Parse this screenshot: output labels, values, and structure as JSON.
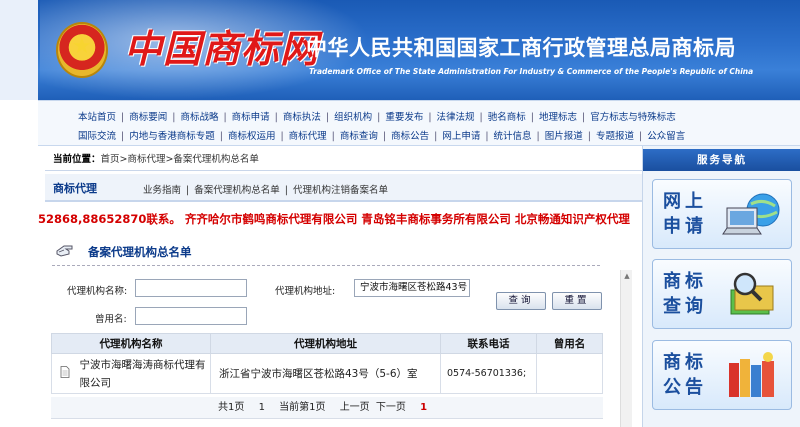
{
  "header": {
    "logo_text": "中国商标网",
    "title_cn": "中华人民共和国国家工商行政管理总局商标局",
    "title_en": "Trademark Office of The State Administration For Industry & Commerce of the People's Republic of China"
  },
  "nav": {
    "row1": [
      "本站首页",
      "商标要闻",
      "商标战略",
      "商标申请",
      "商标执法",
      "组织机构",
      "重要发布",
      "法律法规",
      "驰名商标",
      "地理标志",
      "官方标志与特殊标志"
    ],
    "row2": [
      "国际交流",
      "内地与香港商标专题",
      "商标权运用",
      "商标代理",
      "商标查询",
      "商标公告",
      "网上申请",
      "统计信息",
      "图片报道",
      "专题报道",
      "公众留言"
    ]
  },
  "breadcrumb": {
    "label": "当前位置：",
    "path": "首页>商标代理>备案代理机构总名单"
  },
  "agency": {
    "title": "商标代理",
    "links": [
      "业务指南",
      "备案代理机构总名单",
      "代理机构注销备案名单"
    ]
  },
  "marquee": {
    "text": "52868,88652870联系。 齐齐哈尔市鹤鸣商标代理有限公司  青岛铭丰商标事务所有限公司  北京畅通知识产权代理"
  },
  "section": {
    "title": "备案代理机构总名单"
  },
  "search_form": {
    "name_label": "代理机构名称:",
    "name_value": "",
    "address_label": "代理机构地址:",
    "address_value": "宁波市海曙区苍松路43号",
    "former_label": "曾用名:",
    "former_value": "",
    "query_button": "查询",
    "reset_button": "重置"
  },
  "table": {
    "headers": [
      "代理机构名称",
      "代理机构地址",
      "联系电话",
      "曾用名"
    ],
    "rows": [
      {
        "name": "宁波市海曙海涛商标代理有限公司",
        "address": "浙江省宁波市海曙区苍松路43号（5-6）室",
        "phone": "0574-56701336;",
        "former_name": ""
      }
    ]
  },
  "pager": {
    "total_pages": "共1页",
    "page_count": "1",
    "current": "当前第1页",
    "prev": "上一页",
    "next": "下一页",
    "page_link": "1"
  },
  "service_nav": {
    "title": "服务导航",
    "cards": [
      {
        "label": "网上申请",
        "icon": "laptop-globe-icon"
      },
      {
        "label": "商标查询",
        "icon": "magnifier-book-icon"
      },
      {
        "label": "商标公告",
        "icon": "books-icon"
      }
    ]
  },
  "colors": {
    "banner_blue": "#2c70cc",
    "nav_link": "#0b3a8a",
    "marquee_red": "#d40000",
    "header_bg": "#e4ebf5"
  }
}
